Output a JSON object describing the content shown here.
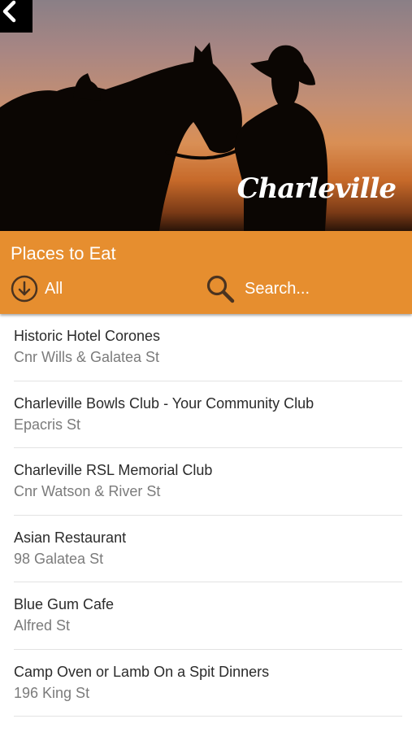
{
  "hero": {
    "brand_text": "Charleville"
  },
  "header": {
    "title": "Places to Eat",
    "filter_label": "All",
    "search_placeholder": "Search..."
  },
  "colors": {
    "accent": "#e68e2f"
  },
  "icons": {
    "back": "chevron-left-icon",
    "filter": "circle-arrow-down-icon",
    "search": "search-icon"
  },
  "places": [
    {
      "name": "Historic Hotel Corones",
      "address": "Cnr Wills & Galatea St"
    },
    {
      "name": "Charleville Bowls Club - Your Community Club",
      "address": "Epacris St"
    },
    {
      "name": "Charleville RSL Memorial Club",
      "address": "Cnr Watson & River St"
    },
    {
      "name": "Asian Restaurant",
      "address": "98 Galatea St"
    },
    {
      "name": "Blue Gum Cafe",
      "address": "Alfred St"
    },
    {
      "name": "Camp Oven or Lamb On a Spit Dinners",
      "address": "196 King St"
    }
  ]
}
